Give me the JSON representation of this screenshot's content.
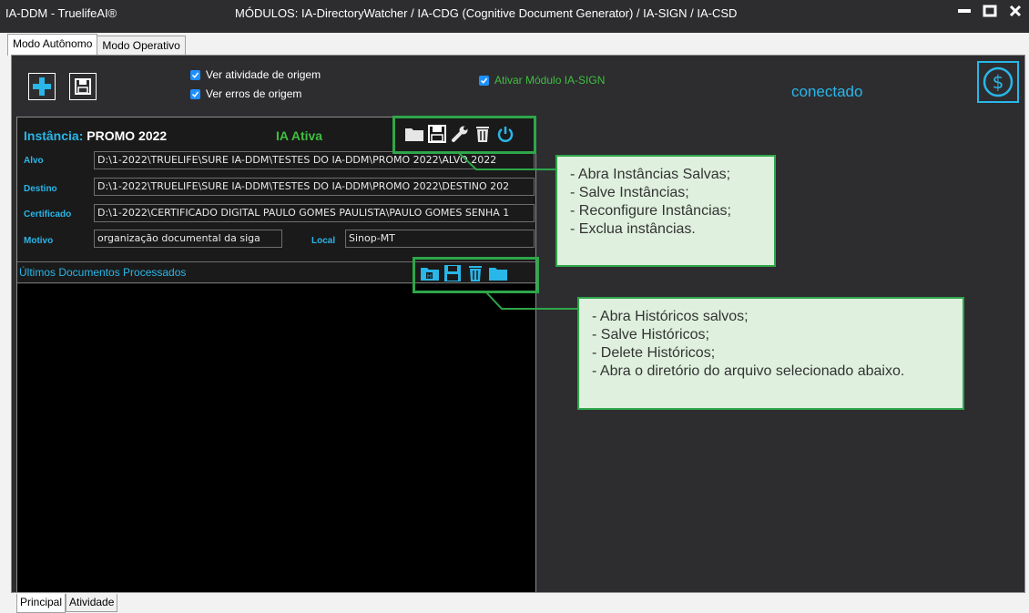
{
  "window": {
    "app_title": "IA-DDM  -  TruelifeAI®",
    "modules_title": "MÓDULOS:  IA-DirectoryWatcher / IA-CDG (Cognitive Document Generator) / IA-SIGN / IA-CSD"
  },
  "top_tabs": [
    "Modo Autônomo",
    "Modo Operativo"
  ],
  "toolbar": {
    "check_activity_label": "Ver atividade de origem",
    "check_errors_label": "Ver erros de origem",
    "check_sign_label": "Ativar Módulo IA-SIGN",
    "status_text": "conectado"
  },
  "instance": {
    "title_label": "Instância:",
    "title_value": "PROMO 2022",
    "state": "IA Ativa",
    "fields": {
      "alvo_label": "Alvo",
      "alvo_value": "D:\\1-2022\\TRUELIFE\\SURE IA-DDM\\TESTES DO IA-DDM\\PROMO 2022\\ALVO 2022",
      "destino_label": "Destino",
      "destino_value": "D:\\1-2022\\TRUELIFE\\SURE IA-DDM\\TESTES DO IA-DDM\\PROMO 2022\\DESTINO 202",
      "certificado_label": "Certificado",
      "certificado_value": "D:\\1-2022\\CERTIFICADO DIGITAL PAULO GOMES PAULISTA\\PAULO GOMES SENHA 1",
      "motivo_label": "Motivo",
      "motivo_value": "organização documental da siga",
      "local_label": "Local",
      "local_value": "Sinop-MT"
    }
  },
  "docs": {
    "title": "Últimos Documentos Processados"
  },
  "callout_instances": [
    "- Abra Instâncias Salvas;",
    "- Salve Instâncias;",
    "- Reconfigure Instâncias;",
    "- Exclua instâncias."
  ],
  "callout_history": [
    "- Abra Históricos salvos;",
    "- Salve Históricos;",
    "- Delete Históricos;",
    "- Abra o diretório do arquivo selecionado abaixo."
  ],
  "bottom_tabs": [
    "Principal",
    "Atividade"
  ],
  "colors": {
    "accent": "#29b6e8",
    "active_green": "#3fbf3f",
    "highlight_green": "#2ea64a",
    "callout_bg": "#dff1de"
  }
}
